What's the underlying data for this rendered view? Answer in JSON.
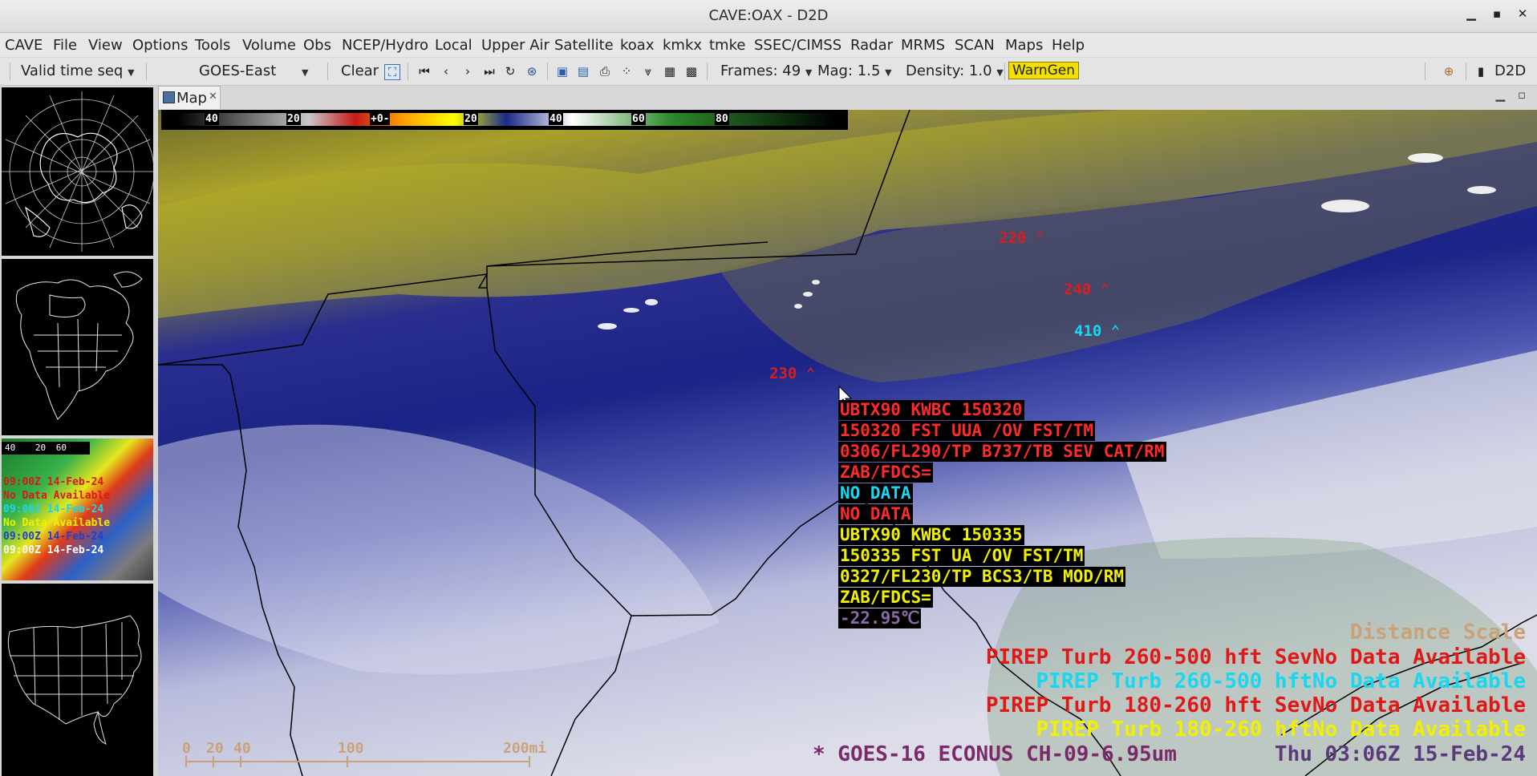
{
  "window": {
    "title": "CAVE:OAX - D2D",
    "minimize": "▁",
    "maximize": "▪",
    "close": "✕"
  },
  "menu": [
    "CAVE",
    "File",
    "View",
    "Options",
    "Tools",
    "Volume",
    "Obs",
    "NCEP/Hydro",
    "Local",
    "Upper Air",
    "Satellite",
    "koax",
    "kmkx",
    "tmke",
    "SSEC/CIMSS",
    "Radar",
    "MRMS",
    "SCAN",
    "Maps",
    "Help"
  ],
  "toolbar": {
    "time_mode": "Valid time seq",
    "source": "GOES-East",
    "clear": "Clear",
    "frames": "Frames: 49",
    "mag": "Mag: 1.5",
    "density": "Density: 1.0",
    "warngen": "WarnGen",
    "perspective": "D2D"
  },
  "tab": {
    "label": "Map"
  },
  "colorbar": {
    "ticks": [
      "40",
      "20",
      "+0-",
      "20",
      "40",
      "60",
      "80"
    ]
  },
  "pireps": [
    {
      "alt": "220",
      "color": "#d42020"
    },
    {
      "alt": "240",
      "color": "#d42020"
    },
    {
      "alt": "410",
      "color": "#19d7f0"
    },
    {
      "alt": "230",
      "color": "#d42020"
    }
  ],
  "sample": [
    {
      "text": "UBTX90 KWBC 150320",
      "color": "#ff2a2a"
    },
    {
      "text": "150320 FST UUA /OV FST/TM",
      "color": "#ff2a2a"
    },
    {
      "text": "0306/FL290/TP B737/TB SEV CAT/RM",
      "color": "#ff2a2a"
    },
    {
      "text": "ZAB/FDCS=",
      "color": "#ff2a2a"
    },
    {
      "text": "NO DATA",
      "color": "#19d7f0"
    },
    {
      "text": "NO DATA",
      "color": "#ff2a2a"
    },
    {
      "text": "UBTX90 KWBC 150335",
      "color": "#f0f000"
    },
    {
      "text": "150335 FST UA /OV FST/TM",
      "color": "#f0f000"
    },
    {
      "text": "0327/FL230/TP BCS3/TB MOD/RM",
      "color": "#f0f000"
    },
    {
      "text": "ZAB/FDCS=",
      "color": "#f0f000"
    },
    {
      "text": "-22.95℃",
      "color": "#8a6aa0"
    }
  ],
  "legend": {
    "distance_scale": "Distance Scale",
    "lines": [
      {
        "text": "PIREP Turb 260-500 hft SevNo Data Available",
        "color": "#e01818"
      },
      {
        "text": "PIREP Turb 260-500 hftNo Data Available",
        "color": "#19d7f0"
      },
      {
        "text": "PIREP Turb 180-260 hft SevNo Data Available",
        "color": "#e01818"
      },
      {
        "text": "PIREP Turb 180-260 hftNo Data Available",
        "color": "#f0f000"
      }
    ],
    "product": "* GOES-16 ECONUS CH-09-6.95um",
    "time": "Thu 03:06Z 15-Feb-24"
  },
  "scale": {
    "labels": [
      "0",
      "20",
      "40",
      "100",
      "200mi"
    ]
  },
  "thumbnail3": {
    "ticks": [
      "40",
      "20",
      "60"
    ],
    "lines": [
      "09:00Z 14-Feb-24",
      "No Data Available",
      "09:00Z 14-Feb-24",
      "No Data Available",
      "09:00Z 14-Feb-24",
      "09:00Z 14-Feb-24"
    ]
  }
}
